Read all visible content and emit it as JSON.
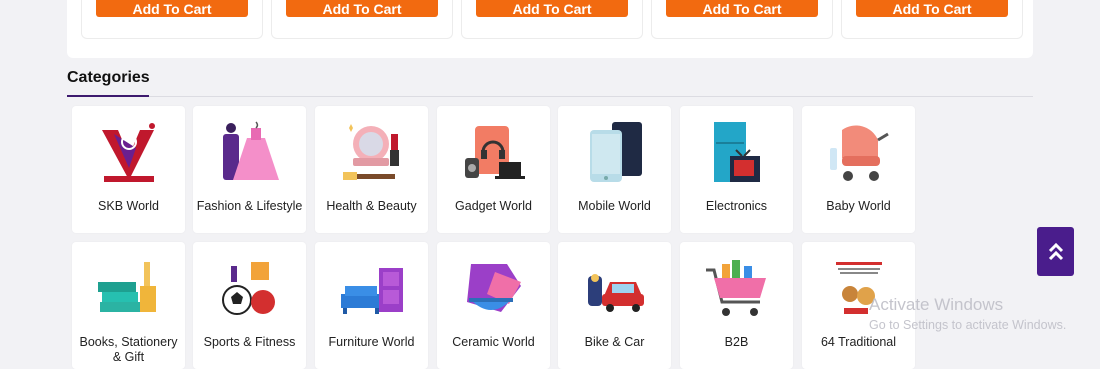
{
  "products": {
    "add_to_cart_label": "Add To Cart"
  },
  "categories_section": {
    "title": "Categories"
  },
  "categories": [
    {
      "label": "SKB World",
      "icon": "skb-logo-icon"
    },
    {
      "label": "Fashion & Lifestyle",
      "icon": "dress-icon"
    },
    {
      "label": "Health & Beauty",
      "icon": "cosmetics-icon"
    },
    {
      "label": "Gadget World",
      "icon": "gadgets-icon"
    },
    {
      "label": "Mobile World",
      "icon": "mobile-phone-icon"
    },
    {
      "label": "Electronics",
      "icon": "appliances-icon"
    },
    {
      "label": "Baby World",
      "icon": "stroller-icon"
    },
    {
      "label": "Books, Stationery & Gift",
      "icon": "books-icon"
    },
    {
      "label": "Sports & Fitness",
      "icon": "sports-icon"
    },
    {
      "label": "Furniture World",
      "icon": "furniture-icon"
    },
    {
      "label": "Ceramic World",
      "icon": "ceramic-icon"
    },
    {
      "label": "Bike & Car",
      "icon": "bike-car-icon"
    },
    {
      "label": "B2B",
      "icon": "shopping-cart-icon"
    },
    {
      "label": "64 Traditional",
      "icon": "traditional-food-icon"
    }
  ],
  "scroll_top": {
    "icon": "double-chevron-up-icon"
  },
  "watermark": {
    "title": "Activate Windows",
    "subtitle": "Go to Settings to activate Windows."
  },
  "colors": {
    "accent_orange": "#f26a10",
    "brand_purple": "#4a1d8c"
  }
}
